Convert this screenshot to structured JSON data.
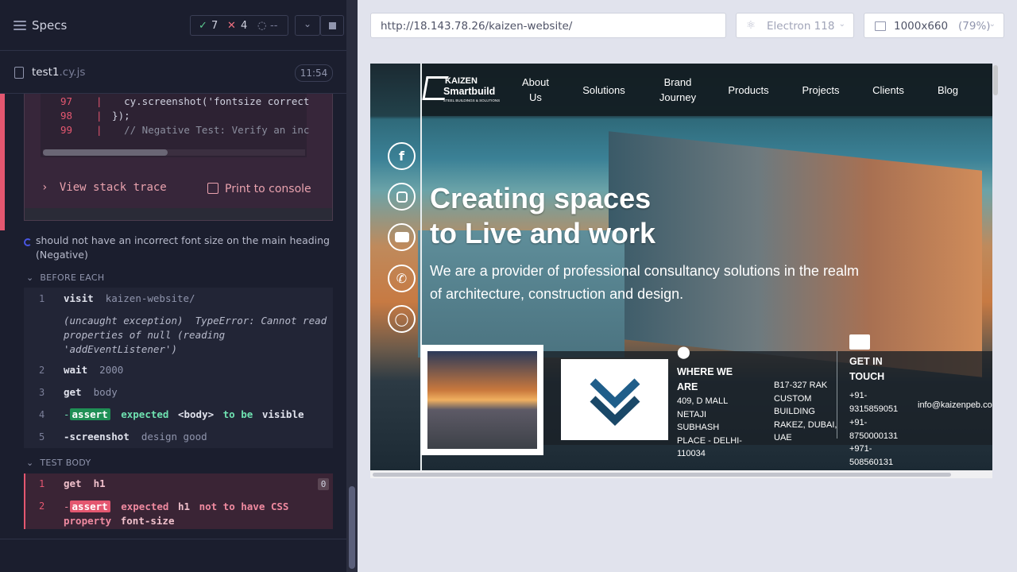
{
  "specs_header": {
    "title": "Specs",
    "passed": "7",
    "failed": "4",
    "pending": "--"
  },
  "file": {
    "name": "test1",
    "ext": ".cy.js",
    "duration": "11:54"
  },
  "code_frame": {
    "lines": [
      {
        "num": "97",
        "text": "    cy.screenshot('fontsize correct"
      },
      {
        "num": "98",
        "text": "  });"
      },
      {
        "num": "99",
        "text": "    // Negative Test: Verify an inc"
      }
    ]
  },
  "error_actions": {
    "stack_trace": "View stack trace",
    "print": "Print to console"
  },
  "current_test": {
    "title": "should not have an incorrect font size on the main heading (Negative)"
  },
  "sections": {
    "before_each": "BEFORE EACH",
    "test_body": "TEST BODY"
  },
  "before_each": {
    "c1": {
      "n": "1",
      "cmd": "visit",
      "arg": "kaizen-website/"
    },
    "err": {
      "a": "(uncaught exception)",
      "b": "TypeError: Cannot read",
      "c": "properties of null (reading",
      "d": "'addEventListener')"
    },
    "c2": {
      "n": "2",
      "cmd": "wait",
      "arg": "2000"
    },
    "c3": {
      "n": "3",
      "cmd": "get",
      "arg": "body"
    },
    "c4": {
      "n": "4",
      "badge": "assert",
      "expected": "expected",
      "subject": "<body>",
      "to_be": "to be",
      "visible": "visible"
    },
    "c5": {
      "n": "5",
      "cmd": "-screenshot",
      "arg": "design good"
    }
  },
  "test_body": {
    "c1": {
      "n": "1",
      "cmd": "get",
      "arg": "h1",
      "count": "0"
    },
    "c2": {
      "n": "2",
      "badge": "assert",
      "expected": "expected",
      "subject": "h1",
      "not_to": "not to have CSS",
      "property": "property",
      "prop": "font-size"
    }
  },
  "browser": {
    "url": "http://18.143.78.26/kaizen-website/",
    "engine": "Electron 118",
    "viewport": "1000x660",
    "scale": "(79%)"
  },
  "site": {
    "logo_top": "KAIZEN",
    "logo_mid": "Smartbuild",
    "logo_small": "STEEL BUILDINGS & SOLUTIONS",
    "nav": {
      "about1": "About",
      "about2": "Us",
      "solutions": "Solutions",
      "brand1": "Brand",
      "brand2": "Journey",
      "products": "Products",
      "projects": "Projects",
      "clients": "Clients",
      "blog": "Blog"
    },
    "heading1": "Creating spaces",
    "heading2": "to Live and work",
    "subtitle": "We are a provider of professional consultancy solutions in the realm of architecture, construction and design.",
    "where_head": "WHERE WE ARE",
    "india_address": "409, D MALL NETAJI SUBHASH PLACE - DELHI-110034",
    "uae_address": "B17-327 RAK CUSTOM BUILDING RAKEZ, DUBAI, UAE",
    "touch_head": "GET IN TOUCH",
    "phone1": "+91-9315859051",
    "phone2": "+91-8750000131",
    "phone3": "+971-508560131",
    "email": "info@kaizenpeb.com"
  }
}
